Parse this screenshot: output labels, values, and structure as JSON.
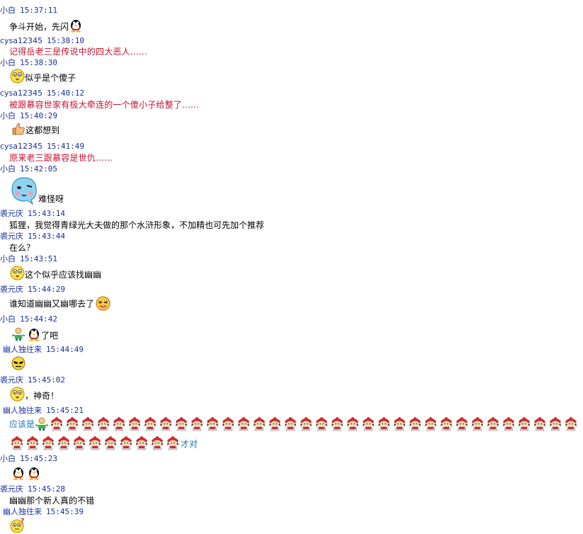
{
  "window": {
    "title": ""
  },
  "colors": {
    "header_text": "#1b2f9e",
    "quote_text": "#c8102e",
    "highlight_text": "#1a76b5",
    "background": "#ffffff"
  },
  "messages": [
    {
      "sender": "小白",
      "time": "15:37:11",
      "text": "争斗开始，先闪",
      "emoticons_after": [
        "penguin-icon"
      ]
    },
    {
      "sender": "cysa12345",
      "time": "15:38:10",
      "text": "记得岳老三是传说中的四大恶人......",
      "style": "red"
    },
    {
      "sender": "小白",
      "time": "15:38:30",
      "emoticons_before": [
        "dazed-face-icon"
      ],
      "text": "似乎是个傻子"
    },
    {
      "sender": "cysa12345",
      "time": "15:40:12",
      "text": "被跟慕容世家有极大牵连的一个傻小子给整了......",
      "style": "red"
    },
    {
      "sender": "小白",
      "time": "15:40:29",
      "emoticons_before": [
        "thumbs-up-icon"
      ],
      "text": "这都想到"
    },
    {
      "sender": "cysa12345",
      "time": "15:41:49",
      "text": "原来老三跟慕容是世仇......",
      "style": "red"
    },
    {
      "sender": "小白",
      "time": "15:42:05",
      "emoticons_before": [
        "blue-blob-face-icon"
      ],
      "text": "难怪呀"
    },
    {
      "sender": "裘元庆",
      "time": "15:43:14",
      "text": "狐狸，我觉得青绿光大夫做的那个水浒形象，不加精也可先加个推荐"
    },
    {
      "sender": "裘元庆",
      "time": "15:43:44",
      "text": "在么？"
    },
    {
      "sender": "小白",
      "time": "15:43:51",
      "emoticons_before": [
        "dazed-face-icon"
      ],
      "text": "这个似乎应该找幽幽"
    },
    {
      "sender": "裘元庆",
      "time": "15:44:29",
      "text": "谁知道幽幽又幽哪去了",
      "emoticons_after": [
        "wink-face-icon"
      ]
    },
    {
      "sender": "小白",
      "time": "15:44:42",
      "emoticons_before": [
        "green-figure-icon",
        "penguin-icon"
      ],
      "text": "了吧"
    },
    {
      "sender": "幽人独往来",
      "time": "15:44:49",
      "emoticons_before": [
        "cool-face-icon"
      ],
      "text": ""
    },
    {
      "sender": "裘元庆",
      "time": "15:45:02",
      "emoticons_before": [
        "dazed-face-icon"
      ],
      "text": "，神奇！"
    },
    {
      "sender": "幽人独往来",
      "time": "15:45:21",
      "text_before": "应该是",
      "emoticons_before": [
        "green-figure-icon"
      ],
      "doll_count": 45,
      "text_after": "才对",
      "style": "blue"
    },
    {
      "sender": "小白",
      "time": "15:45:23",
      "emoticons_before": [
        "penguin-icon",
        "penguin-icon"
      ],
      "text": ""
    },
    {
      "sender": "裘元庆",
      "time": "15:45:28",
      "text": "幽幽那个新人真的不错"
    },
    {
      "sender": "幽人独往来",
      "time": "15:45:39",
      "emoticons_before": [
        "question-face-icon"
      ],
      "text": ""
    }
  ]
}
